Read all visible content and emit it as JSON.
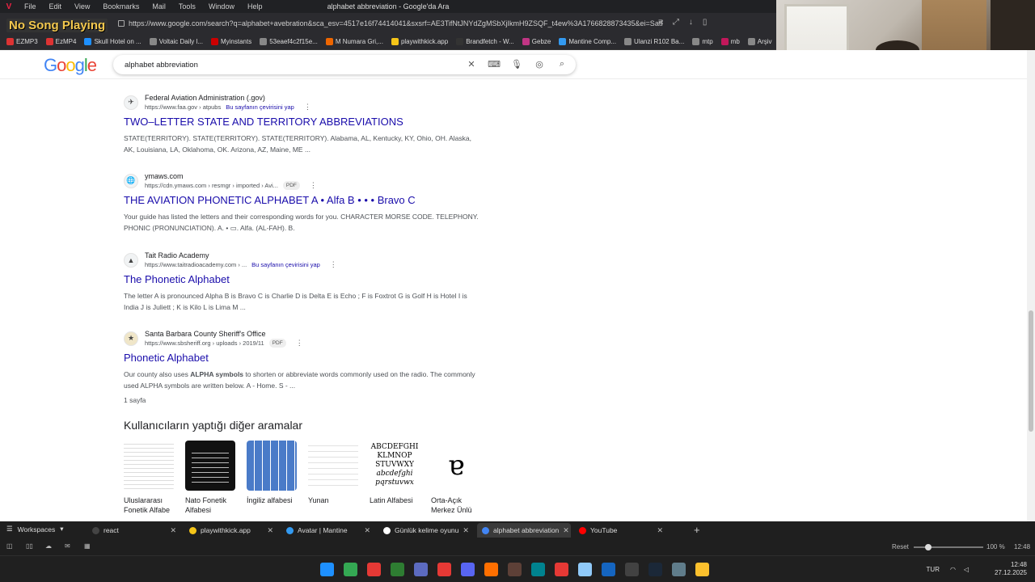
{
  "menubar": {
    "items": [
      "File",
      "Edit",
      "View",
      "Bookmarks",
      "Mail",
      "Tools",
      "Window",
      "Help"
    ],
    "window_title": "alphabet abbreviation - Google'da Ara"
  },
  "overlay": {
    "now_playing": "No Song Playing"
  },
  "address": {
    "url": "https://www.google.com/search?q=alphabet+avebration&sca_esv=4517e16f74414041&sxsrf=AE3TifNtJNYdZgMSbXjIkmH9ZSQF_t4ew%3A1766828873435&ei=SatPaYa..."
  },
  "bookmarks": [
    {
      "label": "EZMP3",
      "color": "#d33"
    },
    {
      "label": "EzMP4",
      "color": "#d33"
    },
    {
      "label": "Skull Hotel on ...",
      "color": "#1e90ff"
    },
    {
      "label": "Voltaic Daily l...",
      "color": "#888"
    },
    {
      "label": "Myinstants",
      "color": "#c00"
    },
    {
      "label": "53eaef4c2f15e...",
      "color": "#888"
    },
    {
      "label": "M Numara Gri,...",
      "color": "#e60"
    },
    {
      "label": "playwithkick.app",
      "color": "#f5c518"
    },
    {
      "label": "Brandfetch - W...",
      "color": "#333"
    },
    {
      "label": "Gebze",
      "color": "#c13584"
    },
    {
      "label": "Mantine Comp...",
      "color": "#339af0"
    },
    {
      "label": "Ulanzi R102 Ba...",
      "color": "#888"
    },
    {
      "label": "mtp",
      "color": "#888"
    },
    {
      "label": "mb",
      "color": "#c2185b"
    },
    {
      "label": "Arşiv",
      "color": "#888"
    }
  ],
  "search": {
    "query": "alphabet abbreviation"
  },
  "results": [
    {
      "site": "Federal Aviation Administration (.gov)",
      "url": "https://www.faa.gov › atpubs",
      "translate": "Bu sayfanın çevirisini yap",
      "pdf": "",
      "title": "TWO–LETTER STATE AND TERRITORY ABBREVIATIONS",
      "snippet": "STATE(TERRITORY). STATE(TERRITORY). STATE(TERRITORY). Alabama, AL, Kentucky, KY, Ohio, OH. Alaska, AK, Louisiana, LA, Oklahoma, OK. Arizona, AZ, Maine, ME ...",
      "extra": ""
    },
    {
      "site": "ymaws.com",
      "url": "https://cdn.ymaws.com › resmgr › imported › Avi...",
      "translate": "",
      "pdf": "PDF",
      "title": "THE AVIATION PHONETIC ALPHABET A • Alfa B • • • Bravo C",
      "snippet": "Your guide has listed the letters and their corresponding words for you. CHARACTER MORSE CODE. TELEPHONY. PHONIC (PRONUNCIATION). A. • ▭. Alfa. (AL-FAH). B.",
      "extra": ""
    },
    {
      "site": "Tait Radio Academy",
      "url": "https://www.taitradioacademy.com › ...",
      "translate": "Bu sayfanın çevirisini yap",
      "pdf": "",
      "title": "The Phonetic Alphabet",
      "snippet": "The letter A is pronounced Alpha B is Bravo C is Charlie D is Delta E is Echo ; F is Foxtrot G is Golf H is Hotel I is India J is Juliett ; K is Kilo L is Lima M ...",
      "extra": ""
    },
    {
      "site": "Santa Barbara County Sheriff's Office",
      "url": "https://www.sbsheriff.org › uploads › 2019/11",
      "translate": "",
      "pdf": "PDF",
      "title": "Phonetic Alphabet",
      "snippet_pre": "Our county also uses ",
      "snippet_bold": "ALPHA symbols",
      "snippet_post": " to shorten or abbreviate words commonly used on the radio. The commonly used ALPHA symbols are written below. A - Home. S - ...",
      "extra": "1 sayfa"
    }
  ],
  "people_also_search": {
    "heading": "Kullanıcıların yaptığı diğer aramalar",
    "cards": [
      {
        "label": "Uluslararası Fonetik Alfabe"
      },
      {
        "label": "Nato Fonetik Alfabesi"
      },
      {
        "label": "İngiliz alfabesi"
      },
      {
        "label": "Yunan"
      },
      {
        "label": "Latin Alfabesi"
      },
      {
        "label": "Orta-Açık Merkez Ünlü"
      }
    ]
  },
  "tabs": {
    "workspaces_label": "Workspaces",
    "items": [
      {
        "label": "react",
        "color": "#444",
        "active": false
      },
      {
        "label": "playwithkick.app",
        "color": "#f5c518",
        "active": false
      },
      {
        "label": "Avatar | Mantine",
        "color": "#339af0",
        "active": false
      },
      {
        "label": "Günlük kelime oyunu",
        "color": "#ffffff",
        "active": false
      },
      {
        "label": "alphabet abbreviation",
        "color": "#4285f4",
        "active": true
      },
      {
        "label": "YouTube",
        "color": "#ff0000",
        "active": false
      }
    ]
  },
  "statusbar": {
    "reset": "Reset",
    "zoom": "100 %",
    "time": "12:48"
  },
  "taskbar": {
    "lang": "TUR",
    "time": "12:48",
    "date": "27.12.2025",
    "icons": [
      "#1e90ff",
      "#34a853",
      "#e53935",
      "#2e7d32",
      "#5c6bc0",
      "#e53935",
      "#5865f2",
      "#ff6f00",
      "#5d4037",
      "#00838f",
      "#e53935",
      "#90caf9",
      "#1565c0",
      "#424242",
      "#1b2838",
      "#607d8b",
      "#fbc02d"
    ]
  }
}
